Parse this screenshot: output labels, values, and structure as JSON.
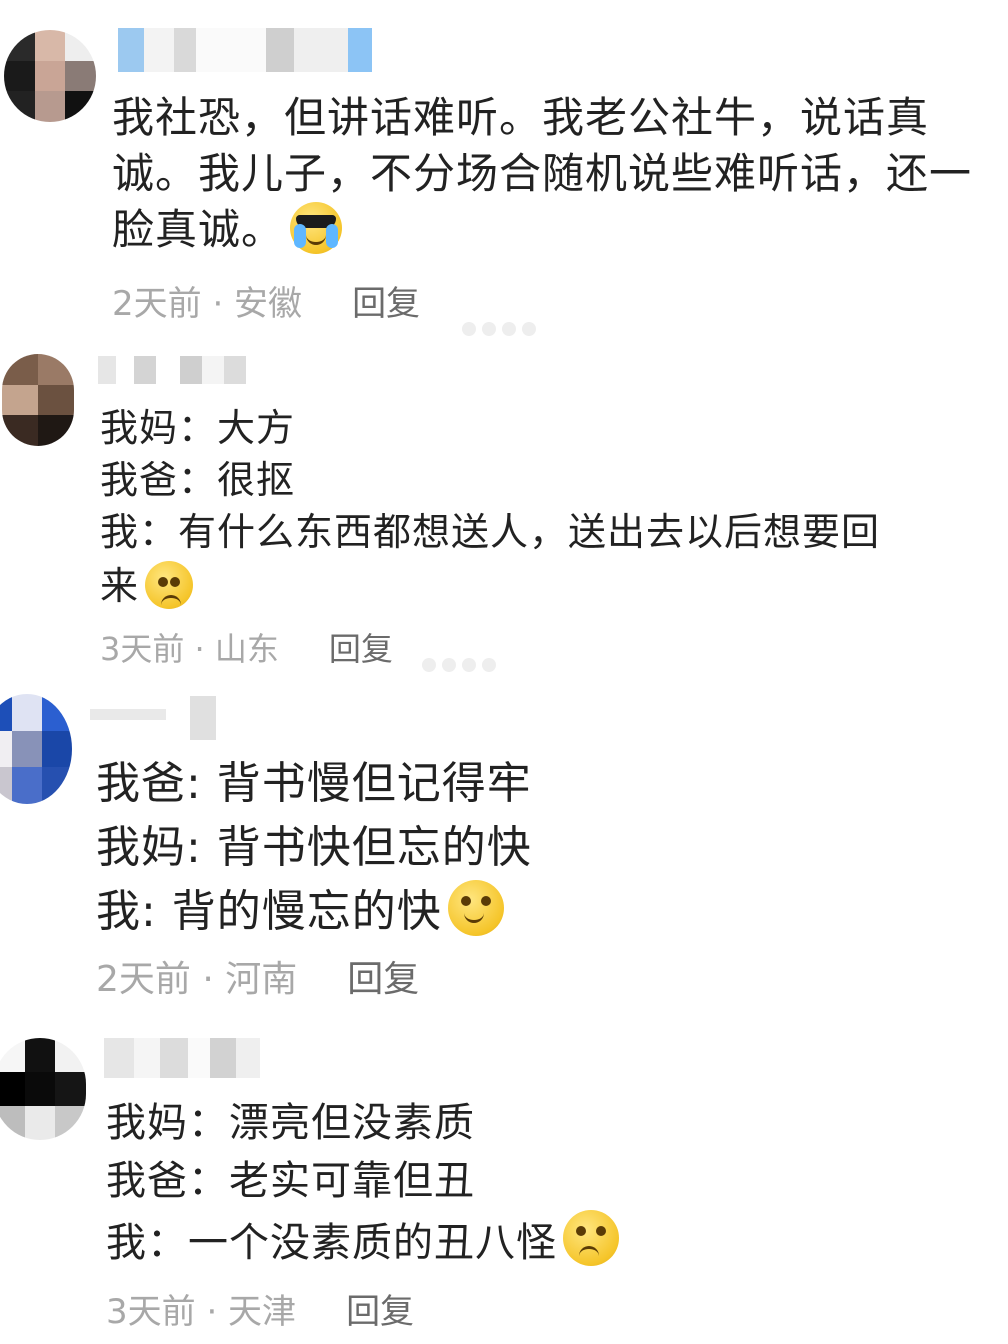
{
  "comments": [
    {
      "lines": [
        "我社恐，但讲话难听。我老公社牛，说话真",
        "诚。我儿子，不分场合随机说些难听话，还一",
        "脸真诚。"
      ],
      "emoji": "crying-sunglasses-emoji",
      "time": "2天前 · 安徽",
      "reply": "回复"
    },
    {
      "lines": [
        "我妈：大方",
        "我爸：很抠",
        "我：有什么东西都想送人，送出去以后想要回",
        "来"
      ],
      "emoji": "pleading-face-emoji",
      "time": "3天前 · 山东",
      "reply": "回复"
    },
    {
      "lines": [
        "我爸: 背书慢但记得牢",
        "我妈: 背书快但忘的快",
        "我: 背的慢忘的快"
      ],
      "emoji": "flushed-smile-emoji",
      "time": "2天前 · 河南",
      "reply": "回复"
    },
    {
      "lines": [
        "我妈：漂亮但没素质",
        "我爸：老实可靠但丑",
        "我：一个没素质的丑八怪"
      ],
      "emoji": "pleading-face-emoji",
      "time": "3天前 · 天津",
      "reply": "回复"
    }
  ]
}
